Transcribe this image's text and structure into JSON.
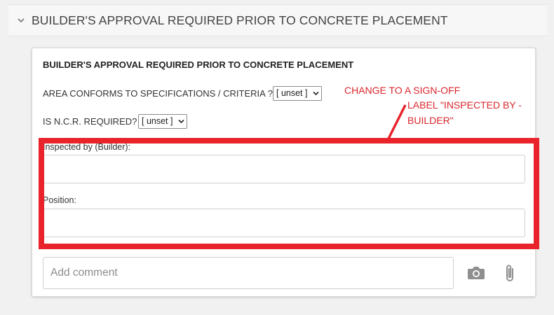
{
  "section": {
    "title": "BUILDER'S APPROVAL REQUIRED PRIOR TO CONCRETE PLACEMENT",
    "icon": "chevron-down-icon"
  },
  "form": {
    "title": "BUILDER'S APPROVAL REQUIRED PRIOR TO CONCRETE PLACEMENT",
    "questions": [
      {
        "label": "AREA CONFORMS TO SPECIFICATIONS / CRITERIA ?",
        "value": "[ unset ]"
      },
      {
        "label": "IS N.C.R. REQUIRED?",
        "value": "[ unset ]"
      }
    ],
    "fields": [
      {
        "label": "Inspected by (Builder):",
        "value": ""
      },
      {
        "label": "Position:",
        "value": ""
      }
    ]
  },
  "annotation": {
    "line1": "CHANGE TO A SIGN-OFF",
    "line2": "LABEL \"INSPECTED BY -",
    "line3": "BUILDER\"",
    "color": "#e8232b"
  },
  "comment": {
    "placeholder": "Add comment",
    "camera_icon": "camera-icon",
    "attach_icon": "paperclip-icon"
  }
}
